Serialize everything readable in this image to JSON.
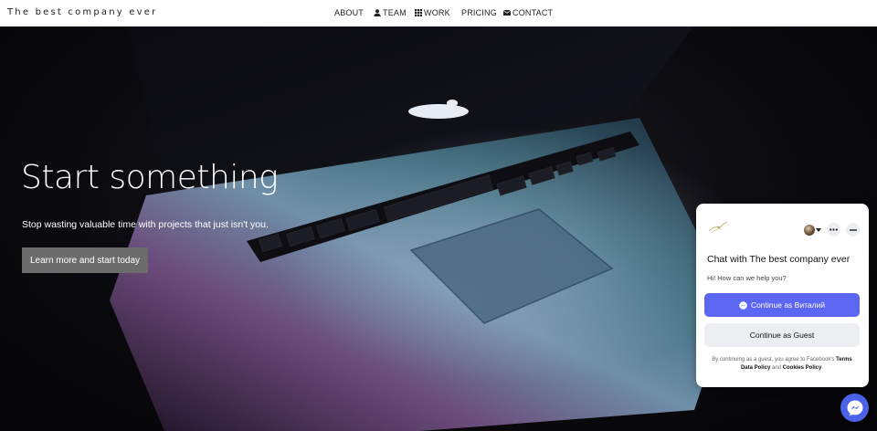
{
  "header": {
    "brand": "The best company ever",
    "nav": [
      {
        "label": "ABOUT",
        "icon": ""
      },
      {
        "label": "TEAM",
        "icon": "user-icon"
      },
      {
        "label": "WORK",
        "icon": "grid-icon"
      },
      {
        "label": "PRICING",
        "icon": ""
      },
      {
        "label": "CONTACT",
        "icon": "envelope-icon"
      }
    ]
  },
  "hero": {
    "title": "Start something",
    "subtitle": "Stop wasting valuable time with projects that just isn't you.",
    "cta_label": "Learn more and start today"
  },
  "chat": {
    "title": "Chat with The best company ever",
    "greeting": "Hi! How can we help you?",
    "continue_as_user": "Continue as Виталий",
    "continue_as_guest": "Continue as Guest",
    "legal_prefix": "By continuing as a guest, you agree to Facebook's",
    "terms": "Terms",
    "data_policy": "Data Policy",
    "and": "and",
    "cookies_policy": "Cookies Policy",
    "primary_color": "#5b67f2"
  },
  "fab": {
    "icon": "messenger-icon",
    "color": "#4a62e8"
  }
}
